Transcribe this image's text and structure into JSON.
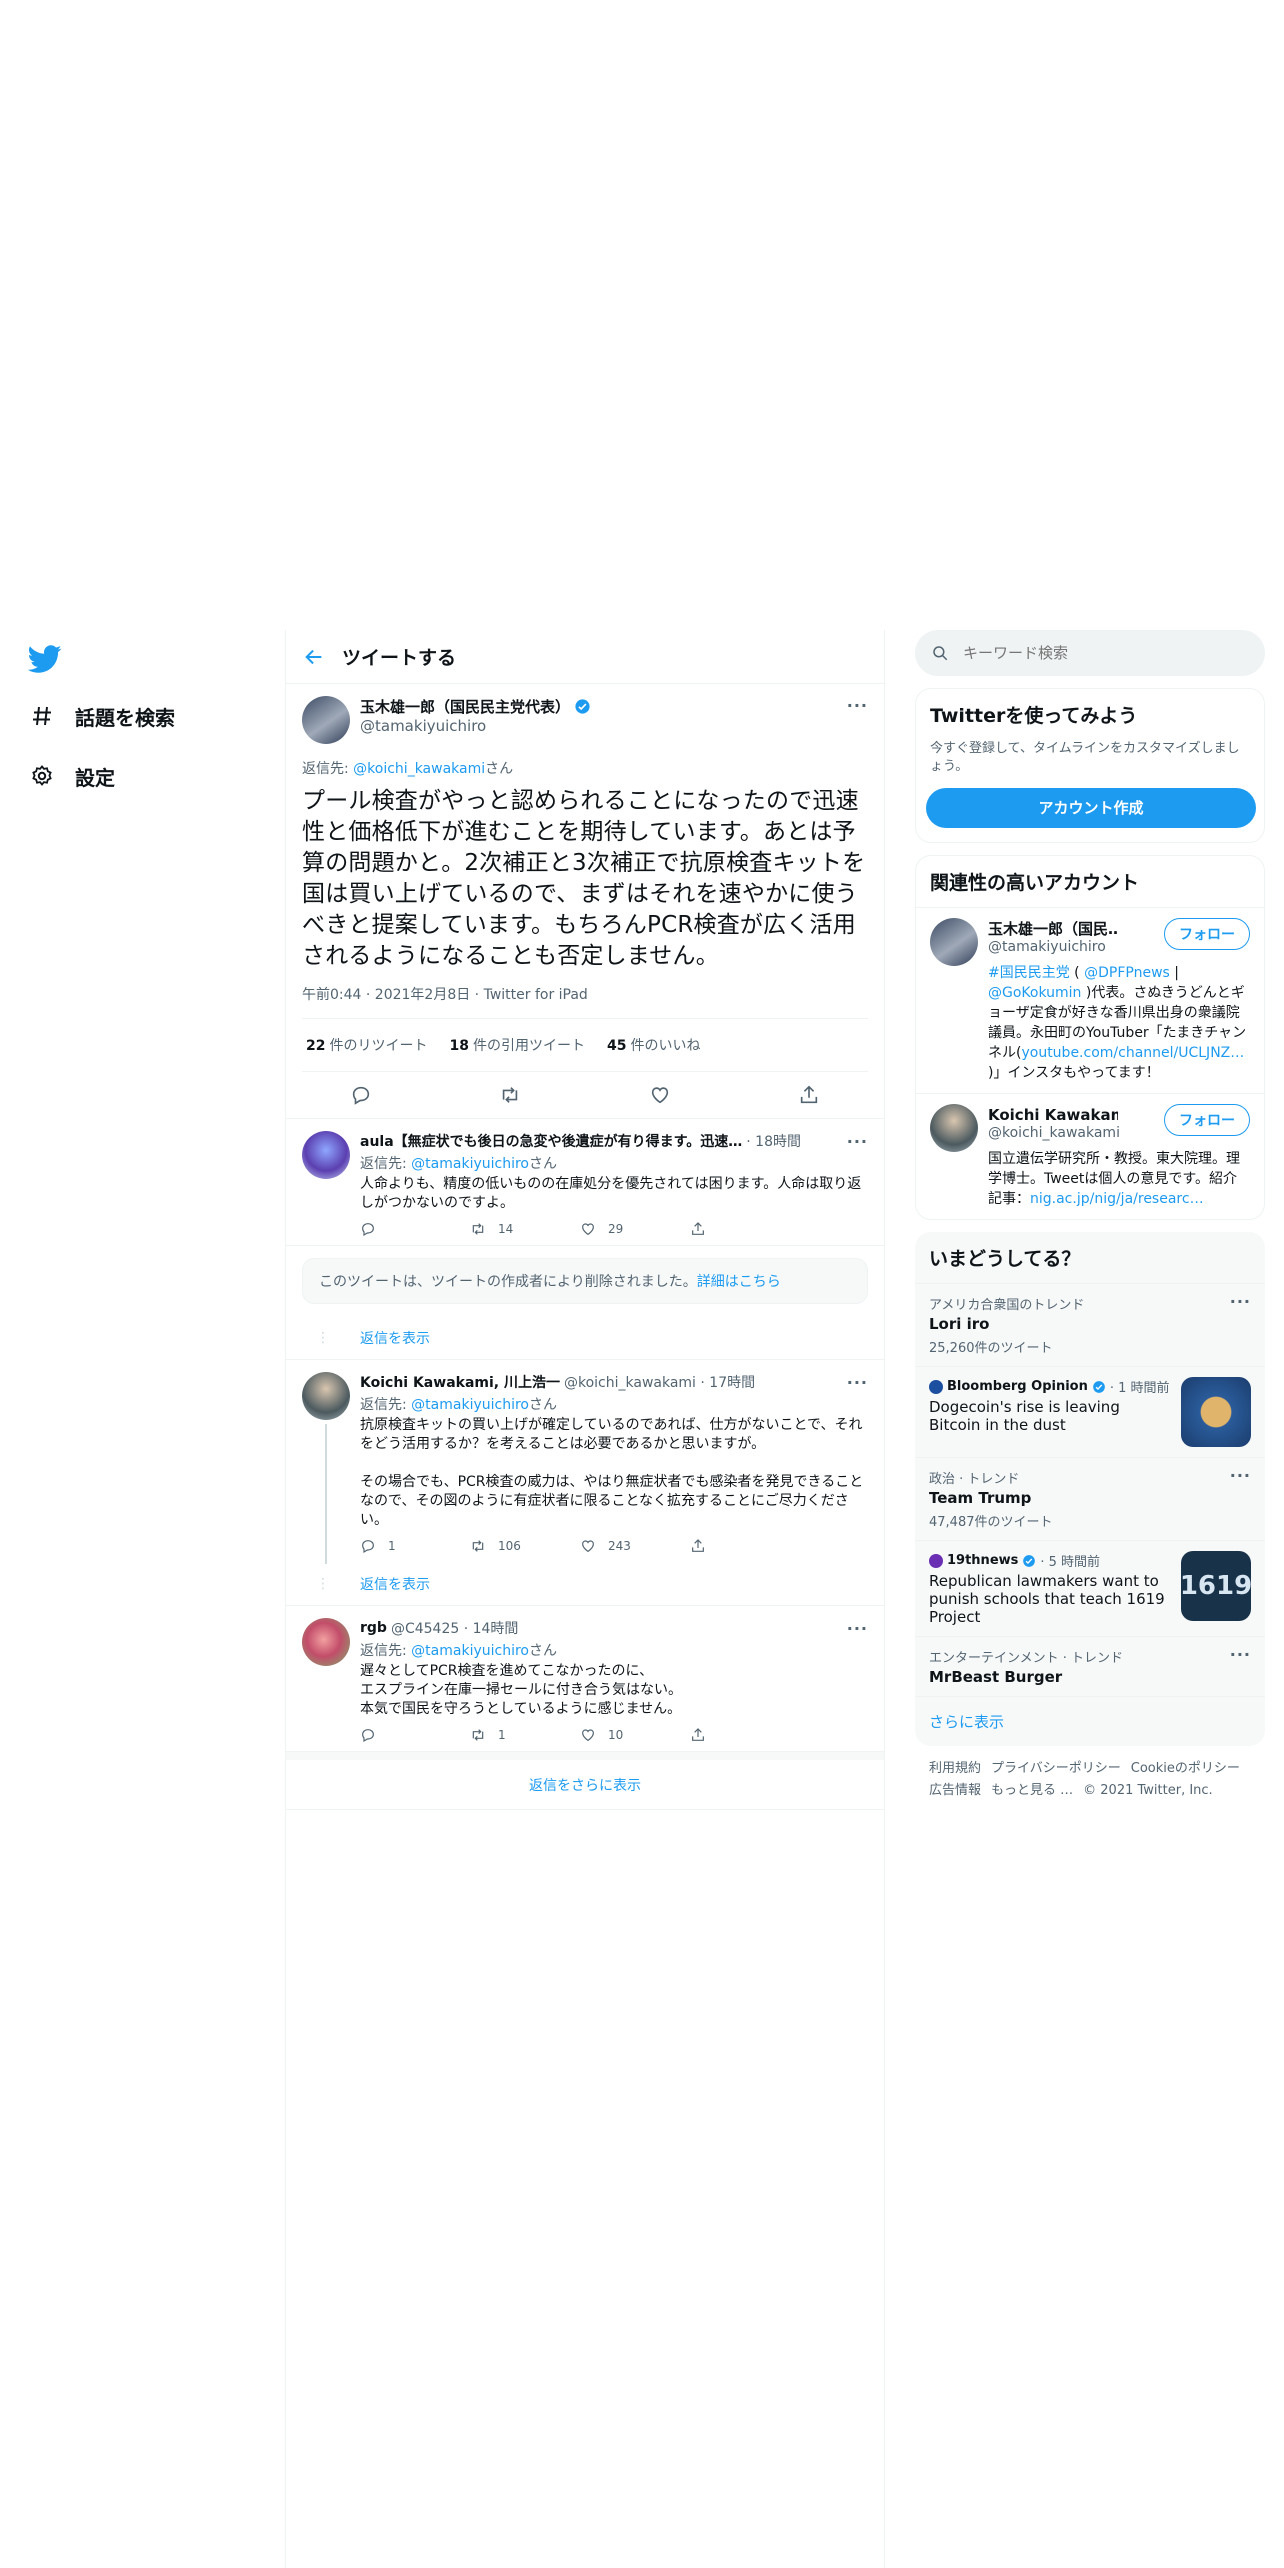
{
  "nav": {
    "explore": "話題を検索",
    "settings": "設定"
  },
  "header": {
    "title": "ツイートする"
  },
  "main_tweet": {
    "name": "玉木雄一郎（国民民主党代表）",
    "handle": "@tamakiyuichiro",
    "reply_label": "返信先: ",
    "reply_handle": "@koichi_kawakami",
    "reply_suffix": "さん",
    "text": "プール検査がやっと認められることになったので迅速性と価格低下が進むことを期待しています。あとは予算の問題かと。2次補正と3次補正で抗原検査キットを国は買い上げているので、まずはそれを速やかに使うべきと提案しています。もちろんPCR検査が広く活用されるようになることも否定しません。",
    "meta": "午前0:44 · 2021年2月8日 · Twitter for iPad",
    "retweets": "22",
    "retweets_label": "件のリツイート",
    "quotes": "18",
    "quotes_label": "件の引用ツイート",
    "likes": "45",
    "likes_label": "件のいいね"
  },
  "replies": [
    {
      "name": "aula【無症状でも後日の急変や後遺症が有り得ます。迅速…",
      "meta": "· 18時間",
      "reply_label": "返信先: ",
      "reply_handle": "@tamakiyuichiro",
      "reply_suffix": "さん",
      "text": "人命よりも、精度の低いものの在庫処分を優先されては困ります。人命は取り返しがつかないのですよ。",
      "reply_count": "",
      "retweet_count": "14",
      "like_count": "29"
    },
    {
      "name": "Koichi Kawakami, 川上浩一",
      "meta": "@koichi_kawakami · 17時間",
      "reply_label": "返信先: ",
      "reply_handle": "@tamakiyuichiro",
      "reply_suffix": "さん",
      "text": "抗原検査キットの買い上げが確定しているのであれば、仕方がないことで、それをどう活用するか？を考えることは必要であるかと思いますが。\n\nその場合でも、PCR検査の威力は、やはり無症状者でも感染者を発見できることなので、その図のように有症状者に限ることなく拡充することにご尽力ください。",
      "reply_count": "1",
      "retweet_count": "106",
      "like_count": "243"
    },
    {
      "name": "rgb",
      "meta": "@C45425 · 14時間",
      "reply_label": "返信先: ",
      "reply_handle": "@tamakiyuichiro",
      "reply_suffix": "さん",
      "text": "遅々としてPCR検査を進めてこなかったのに、\nエスプライン在庫一掃セールに付き合う気はない。\n本気で国民を守ろうとしているように感じません。",
      "reply_count": "",
      "retweet_count": "1",
      "like_count": "10"
    }
  ],
  "deleted_notice": {
    "text": "このツイートは、ツイートの作成者により削除されました。",
    "link": "詳細はこちら"
  },
  "show_replies": "返信を表示",
  "more_replies": "返信をさらに表示",
  "right": {
    "search_placeholder": "キーワード検索",
    "try_title": "Twitterを使ってみよう",
    "try_sub": "今すぐ登録して、タイムラインをカスタマイズしましょう。",
    "signup": "アカウント作成",
    "related_title": "関連性の高いアカウント",
    "follow": "フォロー",
    "accounts": [
      {
        "name": "玉木雄一郎（国民…",
        "handle": "@tamakiyuichiro",
        "bio_link1": "#国民民主党",
        "bio_t1": " ( ",
        "bio_link2": "@DPFPnews",
        "bio_t2": " | ",
        "bio_link3": "@GoKokumin",
        "bio_t3": " )代表。さぬきうどんとギョーザ定食が好きな香川県出身の衆議院議員。永田町のYouTuber「たまきチャンネル(",
        "bio_link4": "youtube.com/channel/UCLJNZ…",
        "bio_t4": " )」インスタもやってます！"
      },
      {
        "name": "Koichi Kawakami, 川…",
        "handle": "@koichi_kawakami",
        "bio_t1": "国立遺伝学研究所・教授。東大院理。理学博士。Tweetは個人の意見です。紹介記事：",
        "bio_link1": "nig.ac.jp/nig/ja/researc…"
      }
    ],
    "trends_title": "いまどうしてる？",
    "trends": [
      {
        "context": "アメリカ合衆国のトレンド",
        "title": "Lori iro",
        "count": "25,260件のツイート"
      },
      {
        "source": "Bloomberg Opinion",
        "time": "· 1 時間前",
        "title": "Dogecoin's rise is leaving Bitcoin in the dust"
      },
      {
        "context": "政治 · トレンド",
        "title": "Team Trump",
        "count": "47,487件のツイート"
      },
      {
        "source": "19thnews",
        "time": "· 5 時間前",
        "title": "Republican lawmakers want to punish schools that teach 1619 Project",
        "thumb_text": "1619"
      },
      {
        "context": "エンターテインメント · トレンド",
        "title": "MrBeast Burger"
      }
    ],
    "show_more": "さらに表示",
    "footer": [
      "利用規約",
      "プライバシーポリシー",
      "Cookieのポリシー",
      "広告情報",
      "もっと見る …",
      "© 2021 Twitter, Inc."
    ]
  },
  "colors": {
    "accent": "#1d9bf0",
    "text": "#0f1419",
    "muted": "#536471"
  }
}
